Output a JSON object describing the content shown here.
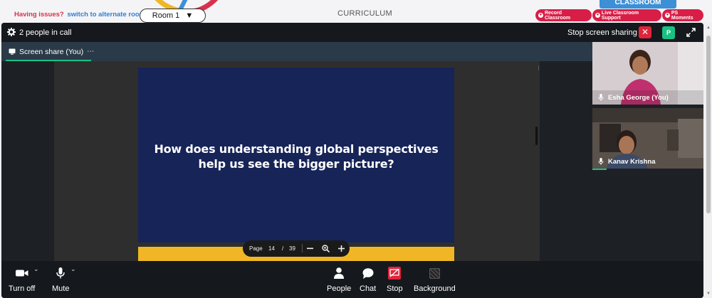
{
  "topbar": {
    "issues_text": "Having issues?",
    "alternate_link": "switch to alternate room",
    "room_value": "Room 1",
    "curriculum": "CURRICULUM",
    "classroom_tab": "CLASSROOM",
    "record_label": "Record Classroom",
    "support_label": "Live Classroom Support",
    "moments_label": "PS Moments"
  },
  "call": {
    "people_count": "2 people in call",
    "stop_sharing": "Stop screen sharing",
    "participant_badge": "P",
    "tab_label": "Screen share (You)",
    "tab_more": "⋯"
  },
  "slide": {
    "line1": "How does understanding global perspectives",
    "line2": "help us see the bigger picture?",
    "page_label": "Page",
    "page_current": "14",
    "page_sep": "/",
    "page_total": "39"
  },
  "participants": [
    {
      "name": "Esha George (You)"
    },
    {
      "name": "Kanav Krishna"
    }
  ],
  "controls": {
    "turn_off": "Turn off",
    "mute": "Mute",
    "people": "People",
    "chat": "Chat",
    "stop": "Stop",
    "background": "Background"
  },
  "colors": {
    "accent_green": "#19c283",
    "alert_red": "#e0243a",
    "slide_navy": "#172457",
    "slide_yellow": "#f0b625"
  }
}
